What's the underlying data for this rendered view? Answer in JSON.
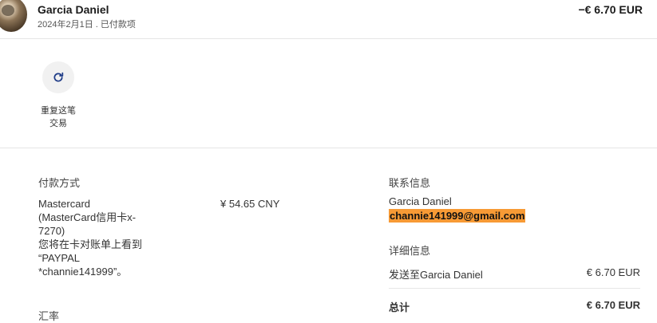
{
  "transaction": {
    "name": "Garcia Daniel",
    "subtitle": "2024年2月1日 . 已付款项",
    "amount": "−€ 6.70 EUR"
  },
  "actions": {
    "repeat_label": "重复这笔交易",
    "repeat_icon": "refresh-icon"
  },
  "payment": {
    "title": "付款方式",
    "method_lines": [
      "Mastercard",
      "(MasterCard信用卡x-",
      "7270)",
      "您将在卡对账单上看到",
      "“PAYPAL",
      "*channie141999”。"
    ],
    "amount_cny": "¥ 54.65 CNY",
    "exchange_title": "汇率"
  },
  "contact": {
    "title": "联系信息",
    "name": "Garcia Daniel",
    "email": "channie141999@gmail.com"
  },
  "details": {
    "title": "详细信息",
    "sent_to_label": "发送至Garcia Daniel",
    "sent_to_amount": "€ 6.70 EUR",
    "total_label": "总计",
    "total_amount": "€ 6.70 EUR"
  },
  "colors": {
    "highlight": "#f79a35",
    "icon": "#1f3c88"
  }
}
